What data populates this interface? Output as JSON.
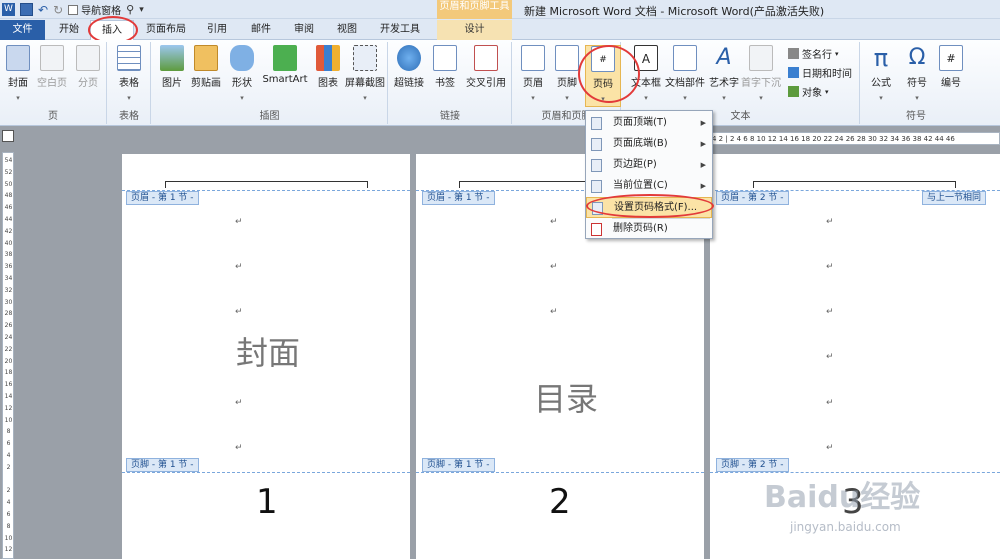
{
  "titlebar": {
    "nav_pane_label": "导航窗格",
    "context_header": "页眉和页脚工具",
    "window_title": "新建 Microsoft Word 文档 - Microsoft Word(产品激活失败)"
  },
  "tabs": [
    "文件",
    "开始",
    "插入",
    "页面布局",
    "引用",
    "邮件",
    "审阅",
    "视图",
    "开发工具",
    "设计"
  ],
  "ribbon": {
    "page_group": {
      "label": "页",
      "cover": "封面",
      "blank": "空白页",
      "break": "分页"
    },
    "table_group": {
      "label": "表格",
      "table": "表格"
    },
    "illustrations": {
      "label": "插图",
      "picture": "图片",
      "clipart": "剪贴画",
      "shapes": "形状",
      "smartart": "SmartArt",
      "chart": "图表",
      "screenshot": "屏幕截图"
    },
    "links": {
      "label": "链接",
      "hyperlink": "超链接",
      "bookmark": "书签",
      "crossref": "交叉引用"
    },
    "header_footer": {
      "label": "页眉和页脚",
      "header": "页眉",
      "footer": "页脚",
      "page_number": "页码"
    },
    "text": {
      "label": "文本",
      "textbox": "文本框",
      "quickparts": "文档部件",
      "wordart": "艺术字",
      "dropcap": "首字下沉",
      "signature": "签名行",
      "datetime": "日期和时间",
      "object": "对象"
    },
    "symbols": {
      "label": "符号",
      "equation": "公式",
      "symbol": "符号",
      "number": "编号"
    }
  },
  "menu": {
    "items": [
      "页面顶端(T)",
      "页面底端(B)",
      "页边距(P)",
      "当前位置(C)",
      "设置页码格式(F)...",
      "删除页码(R)"
    ]
  },
  "ruler": {
    "h_text": "4  2  |  2  4  6  8 10 12 14 16 18 20 22 24 26 28 30 32 34 36 38  42 44 46"
  },
  "pages": [
    {
      "header_tag": "页眉 - 第 1 节 -",
      "footer_tag": "页脚 - 第 1 节 -",
      "title": "封面",
      "number": "1"
    },
    {
      "header_tag": "页眉 - 第 1 节 -",
      "footer_tag": "页脚 - 第 1 节 -",
      "title": "目录",
      "number": "2"
    },
    {
      "header_tag": "页眉 - 第 2 节 -",
      "footer_tag": "页脚 - 第 2 节 -",
      "same_as_prev": "与上一节相同",
      "number": "3"
    }
  ],
  "para_mark": "↵",
  "watermark": {
    "brand": "Baidu经验",
    "url": "jingyan.baidu.com"
  },
  "colors": {
    "file_tab": "#2a5fa8",
    "highlight": "#fbe3a6",
    "annotation": "#e23a3a",
    "context_tab": "#f3c97b"
  }
}
